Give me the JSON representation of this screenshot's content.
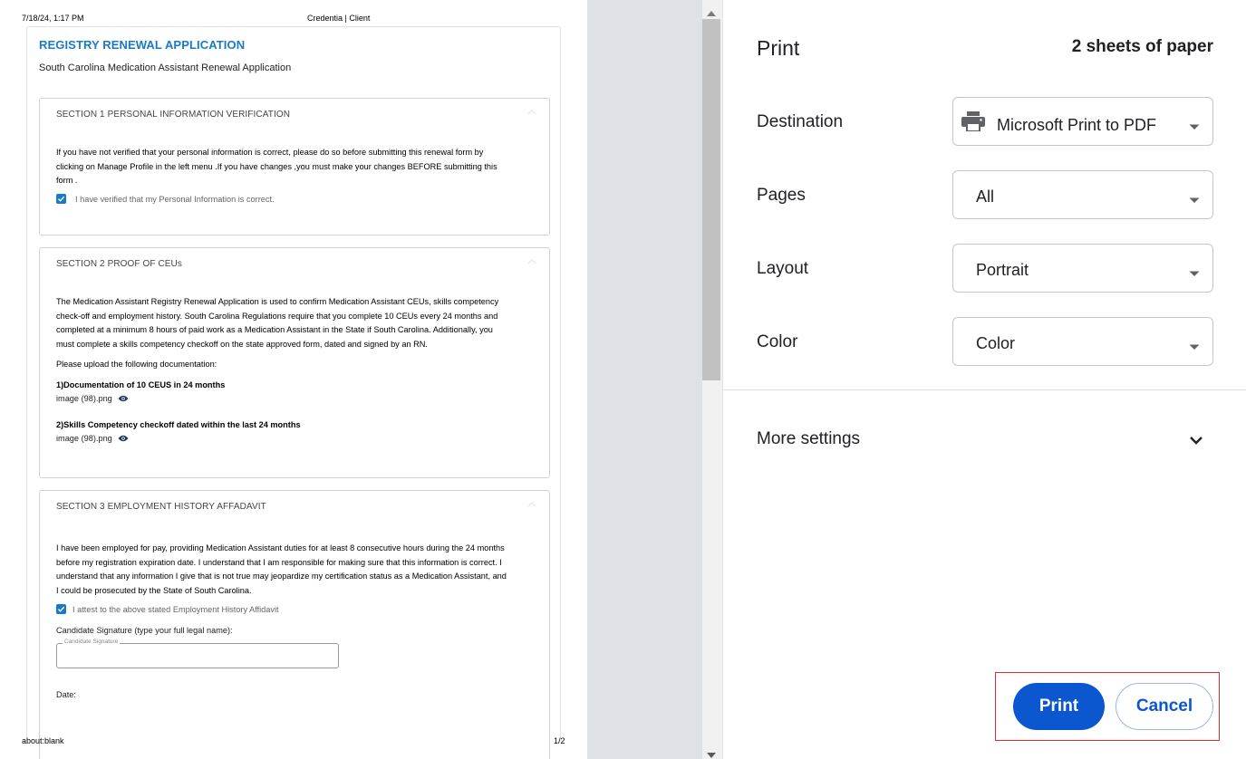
{
  "preview": {
    "header_date": "7/18/24, 1:17 PM",
    "header_title": "Credentia | Client",
    "footer_url": "about:blank",
    "footer_page": "1/2",
    "form_title": "REGISTRY RENEWAL APPLICATION",
    "form_subtitle": "South Carolina Medication Assistant Renewal Application",
    "section1": {
      "heading": "SECTION 1  PERSONAL INFORMATION VERIFICATION",
      "lines": [
        "If you have not verified that your personal information is correct, please do so before submitting this renewal form by",
        "clicking on Manage Profile in the left menu .If you have changes ,you must make your changes BEFORE submitting this",
        "form ."
      ],
      "checkbox_label": "I have verified that my Personal Information is correct."
    },
    "section2": {
      "heading": "SECTION 2  PROOF OF CEUs",
      "lines": [
        "The Medication Assistant Registry Renewal Application is used to confirm Medication Assistant CEUs, skills competency",
        "check-off and employment history. South Carolina Regulations require that you complete 10 CEUs every 24 months and",
        "completed at a minimum 8 hours of paid work as a Medication Assistant in the State if South Carolina. Additionally, you",
        "must complete a skills competency checkoff on the state approved form, dated and signed by an RN."
      ],
      "upload_intro": "Please upload the following documentation:",
      "doc1_label": "1)Documentation of 10 CEUS in 24 months",
      "doc1_file": "image (98).png",
      "doc2_label": "2)Skills Competency checkoff dated within the last 24 months",
      "doc2_file": "image (98).png"
    },
    "section3": {
      "heading": "SECTION 3  EMPLOYMENT HISTORY AFFADAVIT",
      "lines": [
        "I have been employed for pay, providing Medication Assistant duties for at least 8 consecutive hours during the 24 months",
        "before my registration expiration date. I understand that I am responsible for making sure that this information is correct. I",
        "understand that any information I give that is not true may jeopardize my certification status as a Medication Assistant, and",
        "I could be prosecuted by the State of South Carolina."
      ],
      "checkbox_label": "I attest to the above stated Employment History Affidavit",
      "signature_prompt": "Candidate Signature (type your full legal name):",
      "signature_legend": "Candidate Signature",
      "date_label": "Date:"
    }
  },
  "panel": {
    "title": "Print",
    "sheet_count": "2 sheets of paper",
    "destination": {
      "label": "Destination",
      "value": "Microsoft Print to PDF",
      "icon": "printer-icon"
    },
    "pages": {
      "label": "Pages",
      "value": "All"
    },
    "layout": {
      "label": "Layout",
      "value": "Portrait"
    },
    "color": {
      "label": "Color",
      "value": "Color"
    },
    "more_settings": "More settings",
    "print_label": "Print",
    "cancel_label": "Cancel"
  },
  "colors": {
    "accent": "#0b57d0",
    "form_title": "#1a7bc4",
    "highlight_box": "#d4303a",
    "gutter": "#dee1e6"
  }
}
